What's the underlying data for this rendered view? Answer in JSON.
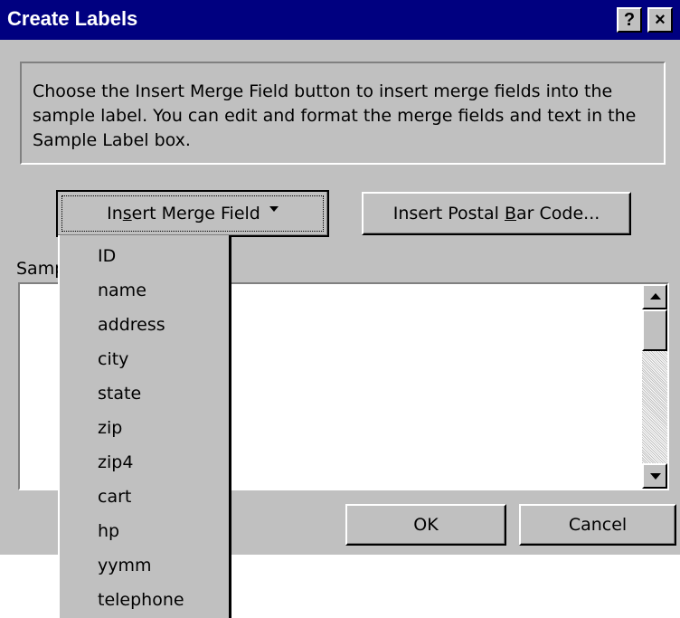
{
  "window": {
    "title": "Create Labels",
    "help_button": "?",
    "close_button": "×"
  },
  "instructions": "Choose the Insert Merge Field button to insert merge fields into the sample label.  You can edit and format the merge fields and text in the Sample Label box.",
  "buttons": {
    "insert_merge_field": {
      "before": "In",
      "accel": "s",
      "after": "ert Merge Field"
    },
    "insert_postal": {
      "before": "Insert Postal ",
      "accel": "B",
      "after": "ar Code..."
    },
    "ok": "OK",
    "cancel": "Cancel"
  },
  "sample": {
    "label_visible": "Samp",
    "text": ""
  },
  "merge_fields": [
    "ID",
    "name",
    "address",
    "city",
    "state",
    "zip",
    "zip4",
    "cart",
    "hp",
    "yymm",
    "telephone"
  ]
}
